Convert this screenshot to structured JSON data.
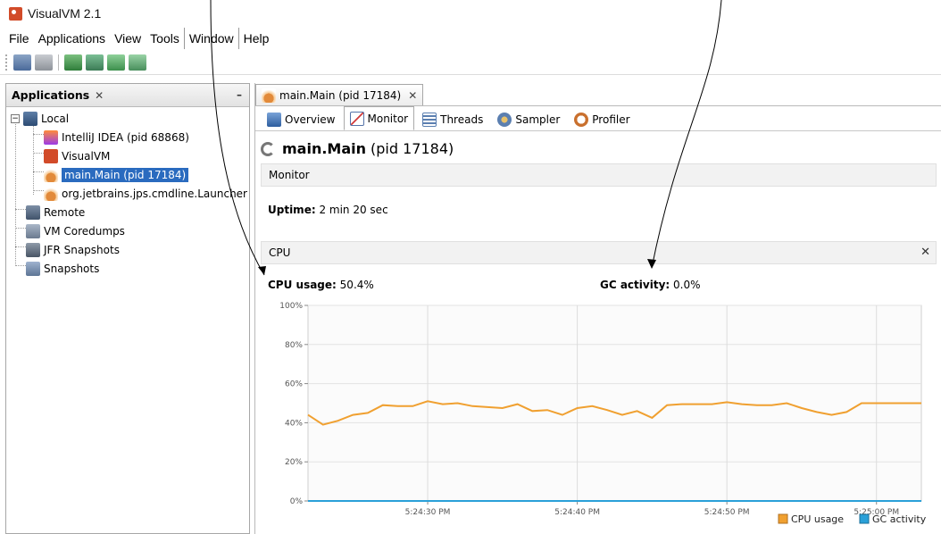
{
  "window": {
    "title": "VisualVM 2.1",
    "app_icon": "visualvm-icon"
  },
  "menu": [
    "File",
    "Applications",
    "View",
    "Tools",
    "Window",
    "Help"
  ],
  "toolbar": {
    "icons": [
      "load-snapshot-icon",
      "save-icon",
      "add-jmx-connection-icon",
      "heap-dump-icon",
      "thread-dump-icon",
      "snapshot-icon"
    ]
  },
  "left_panel": {
    "tab_title": "Applications",
    "close_glyph": "✕",
    "minimize_glyph": "–",
    "tree": {
      "local": "Local",
      "local_toggle": "−",
      "apps": [
        "IntelliJ IDEA (pid 68868)",
        "VisualVM",
        "main.Main (pid 17184)",
        "org.jetbrains.jps.cmdline.Launcher"
      ],
      "selected_app": "main.Main (pid 17184)",
      "others": [
        "Remote",
        "VM Coredumps",
        "JFR Snapshots",
        "Snapshots"
      ]
    }
  },
  "right_panel": {
    "doc_tab": "main.Main (pid 17184)",
    "doc_tab_close": "✕",
    "view_tabs": [
      "Overview",
      "Monitor",
      "Threads",
      "Sampler",
      "Profiler"
    ],
    "active_view_tab": "Monitor",
    "process_name": "main.Main",
    "process_pid": "(pid 17184)",
    "section_monitor": "Monitor",
    "uptime_label": "Uptime:",
    "uptime_value": "2 min 20 sec",
    "section_cpu": "CPU",
    "cpu_close": "✕",
    "cpu_usage_label": "CPU usage:",
    "cpu_usage_value": "50.4%",
    "gc_label": "GC activity:",
    "gc_value": "0.0%"
  },
  "colors": {
    "cpu_series": "#f0a030",
    "gc_series": "#2aa0d8",
    "selection": "#2a6bbf"
  },
  "chart_data": {
    "type": "line",
    "x": [
      "5:24:22",
      "5:24:23",
      "5:24:24",
      "5:24:25",
      "5:24:26",
      "5:24:27",
      "5:24:28",
      "5:24:29",
      "5:24:30",
      "5:24:31",
      "5:24:32",
      "5:24:33",
      "5:24:34",
      "5:24:35",
      "5:24:36",
      "5:24:37",
      "5:24:38",
      "5:24:39",
      "5:24:40",
      "5:24:41",
      "5:24:42",
      "5:24:43",
      "5:24:44",
      "5:24:45",
      "5:24:46",
      "5:24:47",
      "5:24:48",
      "5:24:49",
      "5:24:50",
      "5:24:51",
      "5:24:52",
      "5:24:53",
      "5:24:54",
      "5:24:55",
      "5:24:56",
      "5:24:57",
      "5:24:58",
      "5:24:59",
      "5:25:00",
      "5:25:01",
      "5:25:02",
      "5:25:03"
    ],
    "series": [
      {
        "name": "CPU usage",
        "values": [
          44,
          39,
          41,
          44,
          45,
          49,
          48.5,
          48.5,
          51,
          49.5,
          50,
          48.5,
          48,
          47.5,
          49.5,
          46,
          46.5,
          44,
          47.5,
          48.5,
          46.5,
          44,
          46,
          42.5,
          49,
          49.5,
          49.5,
          49.5,
          50.5,
          49.5,
          49,
          49,
          50,
          47.5,
          45.5,
          44,
          45.5,
          50,
          50,
          50,
          50,
          50
        ]
      },
      {
        "name": "GC activity",
        "values": [
          0,
          0,
          0,
          0,
          0,
          0,
          0,
          0,
          0,
          0,
          0,
          0,
          0,
          0,
          0,
          0,
          0,
          0,
          0,
          0,
          0,
          0,
          0,
          0,
          0,
          0,
          0,
          0,
          0,
          0,
          0,
          0,
          0,
          0,
          0,
          0,
          0,
          0,
          0,
          0,
          0,
          0
        ]
      }
    ],
    "y_ticks": [
      "0%",
      "20%",
      "40%",
      "60%",
      "80%",
      "100%"
    ],
    "x_ticks": [
      "5:24:30 PM",
      "5:24:40 PM",
      "5:24:50 PM",
      "5:25:00 PM"
    ],
    "ylim": [
      0,
      100
    ],
    "grid": true,
    "legend": "bottom-right",
    "legend_labels": [
      "CPU usage",
      "GC activity"
    ]
  }
}
